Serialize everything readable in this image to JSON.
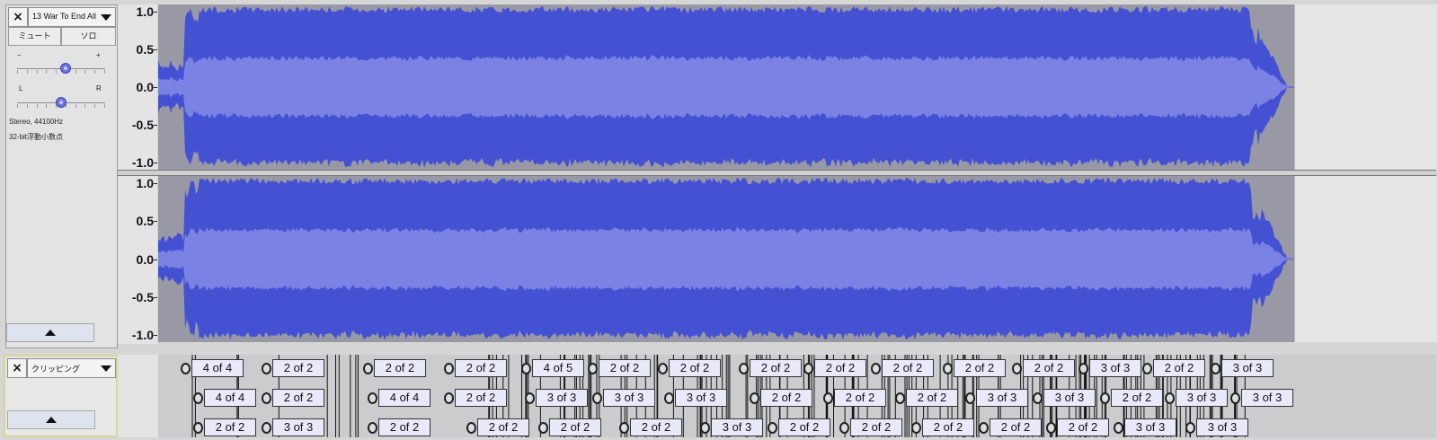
{
  "audio_track": {
    "close_glyph": "×",
    "name": "13 War To End All",
    "mute_label": "ミュート",
    "solo_label": "ソロ",
    "gain_minus": "−",
    "gain_plus": "+",
    "pan_left": "L",
    "pan_right": "R",
    "format_line1": "Stereo, 44100Hz",
    "format_line2": "32-bit浮動小数点",
    "gain_level": 0.55,
    "pan_level": 0.5
  },
  "ruler_labels": [
    "1.0",
    "0.5",
    "0.0",
    "-0.5",
    "-1.0"
  ],
  "label_track": {
    "close_glyph": "×",
    "name": "クリッピング"
  },
  "clip_labels": {
    "row1": [
      "4 of 4",
      "2 of 2",
      "2 of 2",
      "2 of 2",
      "4 of 5",
      "2 of 2",
      "2 of 2",
      "2 of 2",
      "2 of 2",
      "2 of 2",
      "2 of 2",
      "2 of 2",
      "3 of 3",
      "2 of 2",
      "3 of 3"
    ],
    "row2": [
      "4 of 4",
      "2 of 2",
      "4 of 4",
      "2 of 2",
      "3 of 3",
      "3 of 3",
      "3 of 3",
      "2 of 2",
      "2 of 2",
      "2 of 2",
      "3 of 3",
      "3 of 3",
      "2 of 2",
      "3 of 3",
      "3 of 3"
    ],
    "row3": [
      "2 of 2",
      "3 of 3",
      "2 of 2",
      "2 of 2",
      "2 of 2",
      "2 of 2",
      "3 of 3",
      "2 of 2",
      "2 of 2",
      "2 of 2",
      "2 of 2",
      "2 of 2",
      "3 of 3",
      "3 of 3"
    ]
  },
  "colors": {
    "waveform_peak": "#4451d3",
    "waveform_rms": "#7a82e4",
    "waveform_background": "#9999a6",
    "label_fill": "#e9e9f9"
  }
}
